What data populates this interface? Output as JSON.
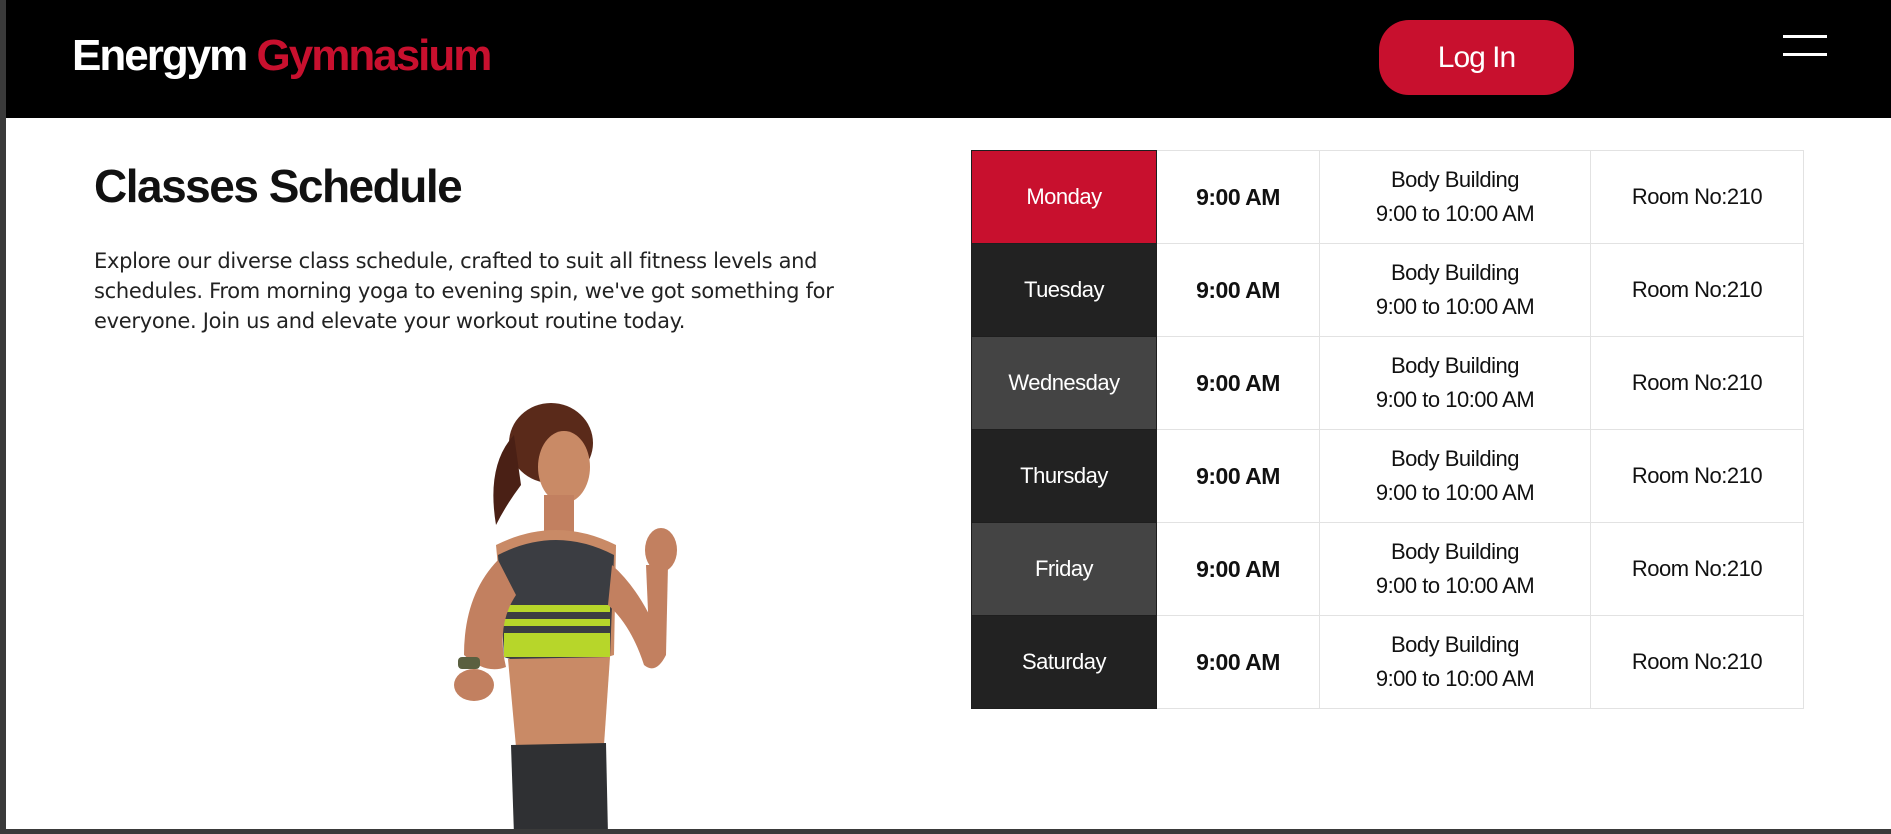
{
  "header": {
    "brand_primary": "Energym",
    "brand_accent": "Gymnasium",
    "login_label": "Log In",
    "menu_icon": "hamburger-menu-icon"
  },
  "intro": {
    "title": "Classes Schedule",
    "description": "Explore our diverse class schedule, crafted to suit all fitness levels and schedules. From morning yoga to evening spin, we've got something for everyone. Join us and elevate your workout routine today."
  },
  "colors": {
    "accent": "#c8102e",
    "header_bg": "#000000",
    "day_dark": "#222222",
    "day_mid": "#444444"
  },
  "schedule": [
    {
      "day": "Monday",
      "time": "9:00 AM",
      "class_name": "Body Building",
      "class_time": "9:00 to 10:00 AM",
      "room": "Room No:210",
      "day_color": "#c8102e"
    },
    {
      "day": "Tuesday",
      "time": "9:00 AM",
      "class_name": "Body Building",
      "class_time": "9:00 to 10:00 AM",
      "room": "Room No:210",
      "day_color": "#222222"
    },
    {
      "day": "Wednesday",
      "time": "9:00 AM",
      "class_name": "Body Building",
      "class_time": "9:00 to 10:00 AM",
      "room": "Room No:210",
      "day_color": "#444444"
    },
    {
      "day": "Thursday",
      "time": "9:00 AM",
      "class_name": "Body Building",
      "class_time": "9:00 to 10:00 AM",
      "room": "Room No:210",
      "day_color": "#222222"
    },
    {
      "day": "Friday",
      "time": "9:00 AM",
      "class_name": "Body Building",
      "class_time": "9:00 to 10:00 AM",
      "room": "Room No:210",
      "day_color": "#444444"
    },
    {
      "day": "Saturday",
      "time": "9:00 AM",
      "class_name": "Body Building",
      "class_time": "9:00 to 10:00 AM",
      "room": "Room No:210",
      "day_color": "#222222"
    }
  ]
}
